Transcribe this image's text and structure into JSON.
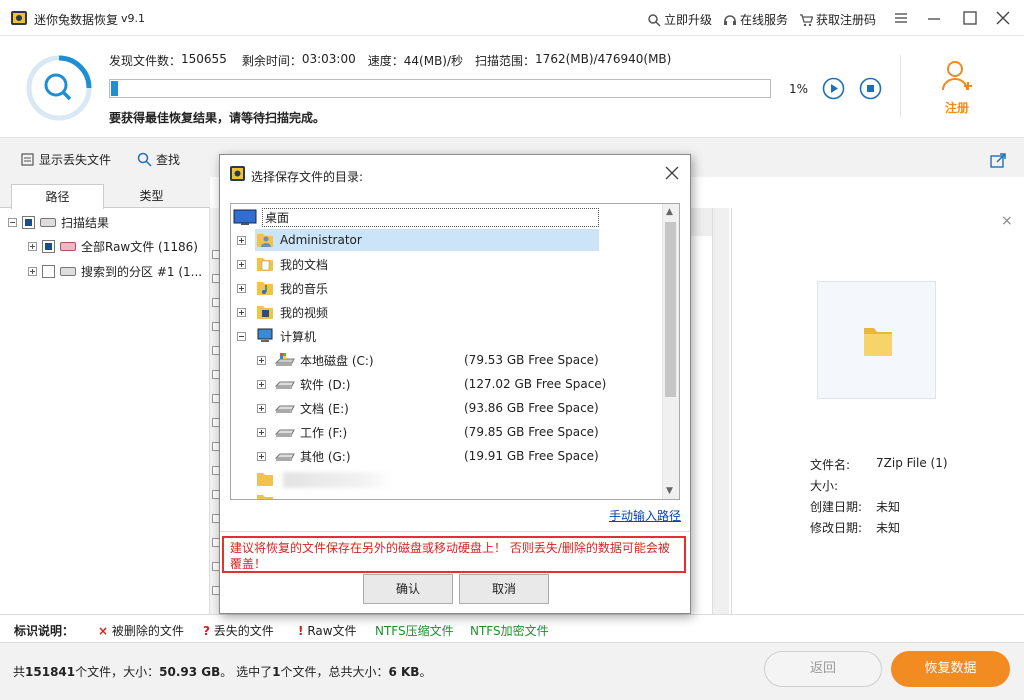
{
  "app": {
    "title": "迷你兔数据恢复",
    "version": "v9.1",
    "links": [
      "立即升级",
      "在线服务",
      "获取注册码"
    ]
  },
  "scan": {
    "found_label": "发现文件数：",
    "found_value": "150655",
    "remaining_label": "剩余时间：",
    "remaining_value": "03:03:00",
    "speed_label": "速度：",
    "speed_value": "44(MB)/秒",
    "range_label": "扫描范围：",
    "range_value": "1762(MB)/476940(MB)",
    "progress_fraction": 0.01,
    "percent": "1%",
    "tip": "要获得最佳恢复结果，请等待扫描完成。",
    "register_label": "注册"
  },
  "toolbar": {
    "show_lost": "显示丢失文件",
    "find": "查找"
  },
  "left": {
    "tab_path": "路径",
    "tab_type": "类型",
    "tree": [
      {
        "label": "扫描结果"
      },
      {
        "label": "全部Raw文件 (1186)"
      },
      {
        "label": "搜索到的分区 #1 (1..."
      }
    ]
  },
  "preview": {
    "close": "×",
    "rows": [
      {
        "k": "文件名:",
        "v": "7Zip File (1)"
      },
      {
        "k": "大小:",
        "v": ""
      },
      {
        "k": "创建日期:",
        "v": "未知"
      },
      {
        "k": "修改日期:",
        "v": "未知"
      }
    ]
  },
  "legend": {
    "title": "标识说明：",
    "deleted": "被删除的文件",
    "lost": "丢失的文件",
    "raw": "Raw文件",
    "ntfs_comp": "NTFS压缩文件",
    "ntfs_enc": "NTFS加密文件",
    "colors": {
      "red": "#d32020",
      "green": "#1f8f2a"
    }
  },
  "status": {
    "text_a": "共",
    "total_files": "151841",
    "text_b": "个文件，大小：",
    "total_size": "50.93 GB",
    "text_c": "。 选中了",
    "selected": "1",
    "text_d": "个文件，总共大小：",
    "selected_size": "6 KB",
    "text_e": "。",
    "back": "返回",
    "recover": "恢复数据"
  },
  "dialog": {
    "title": "选择保存文件的目录:",
    "nodes": {
      "desktop": "桌面",
      "admin": "Administrator",
      "docs": "我的文档",
      "music": "我的音乐",
      "video": "我的视频",
      "computer": "计算机"
    },
    "drives": [
      {
        "name": "本地磁盘 (C:)",
        "free": "(79.53 GB Free Space)"
      },
      {
        "name": "软件 (D:)",
        "free": "(127.02 GB Free Space)"
      },
      {
        "name": "文档 (E:)",
        "free": "(93.86 GB Free Space)"
      },
      {
        "name": "工作 (F:)",
        "free": "(79.85 GB Free Space)"
      },
      {
        "name": "其他 (G:)",
        "free": "(19.91 GB Free Space)"
      }
    ],
    "manual_path": "手动输入路径",
    "warning": "建议将恢复的文件保存在另外的磁盘或移动硬盘上！ 否则丢失/删除的数据可能会被覆盖！",
    "ok": "确认",
    "cancel": "取消"
  }
}
